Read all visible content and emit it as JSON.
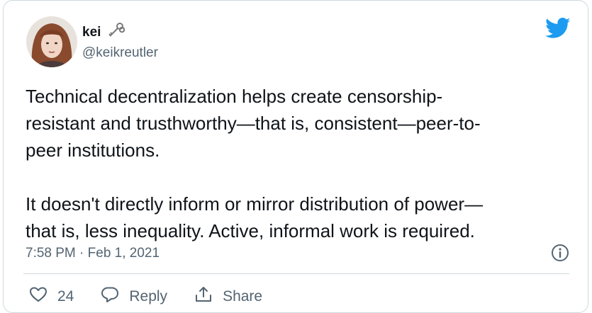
{
  "author": {
    "name": "kei",
    "handle": "@keikreutler"
  },
  "tweet": {
    "text": "Technical decentralization helps create censorship-\nresistant and trusthworthy—that is, consistent—peer-to-\npeer institutions.\n\nIt doesn't directly inform or mirror distribution of power—\nthat is, less inequality. Active, informal work is required.",
    "timestamp": "7:58 PM · Feb 1, 2021"
  },
  "actions": {
    "like_count": "24",
    "reply_label": "Reply",
    "share_label": "Share"
  },
  "icons": [
    "keys-emoji-icon",
    "twitter-logo-icon",
    "info-icon",
    "heart-icon",
    "reply-icon",
    "share-icon"
  ],
  "colors": {
    "brand": "#1d9bf0",
    "text": "#0f1419",
    "secondary": "#536471"
  }
}
